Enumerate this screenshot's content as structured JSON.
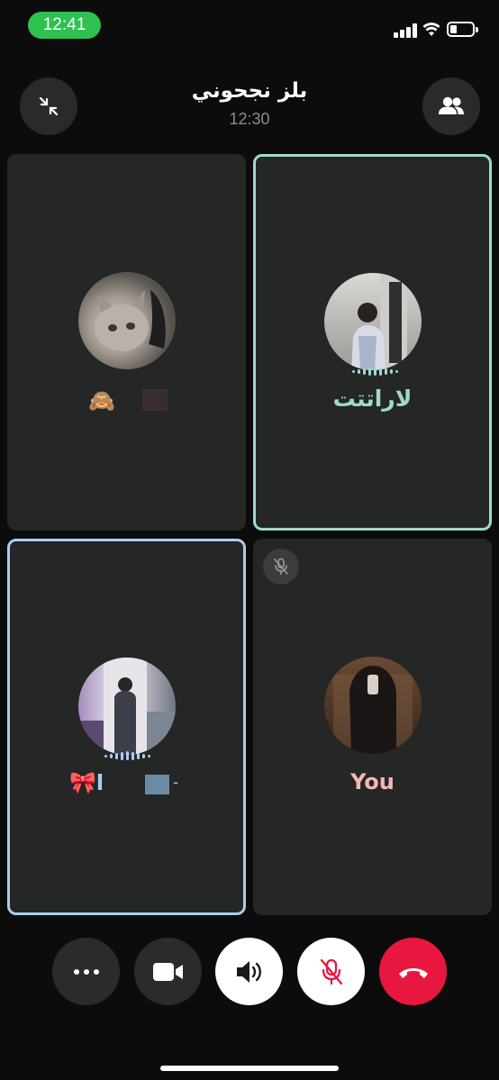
{
  "status_bar": {
    "time": "12:41"
  },
  "header": {
    "title": "بلز نجحوني",
    "duration": "12:30",
    "minimize_icon": "minimize-arrows-icon",
    "participants_icon": "people-icon"
  },
  "participants": [
    {
      "name": "🙈",
      "name_prefix": "",
      "speaking": false,
      "muted": false
    },
    {
      "name": "لاراتتت",
      "speaking": true,
      "muted": false,
      "highlight": "#9fd9cf"
    },
    {
      "name": "🎀ا",
      "speaking": true,
      "muted": false,
      "highlight": "#a8cdf2"
    },
    {
      "name": "You",
      "speaking": false,
      "muted": true,
      "name_color": "#f5b8b2"
    }
  ],
  "controls": [
    {
      "icon": "more-icon"
    },
    {
      "icon": "video-camera-icon"
    },
    {
      "icon": "speaker-icon"
    },
    {
      "icon": "mic-off-icon"
    },
    {
      "icon": "end-call-icon"
    }
  ],
  "colors": {
    "active_teal": "#9fd9cf",
    "active_blue": "#a8cdf2",
    "end_call": "#e8173f",
    "status_green": "#2fc14f"
  }
}
